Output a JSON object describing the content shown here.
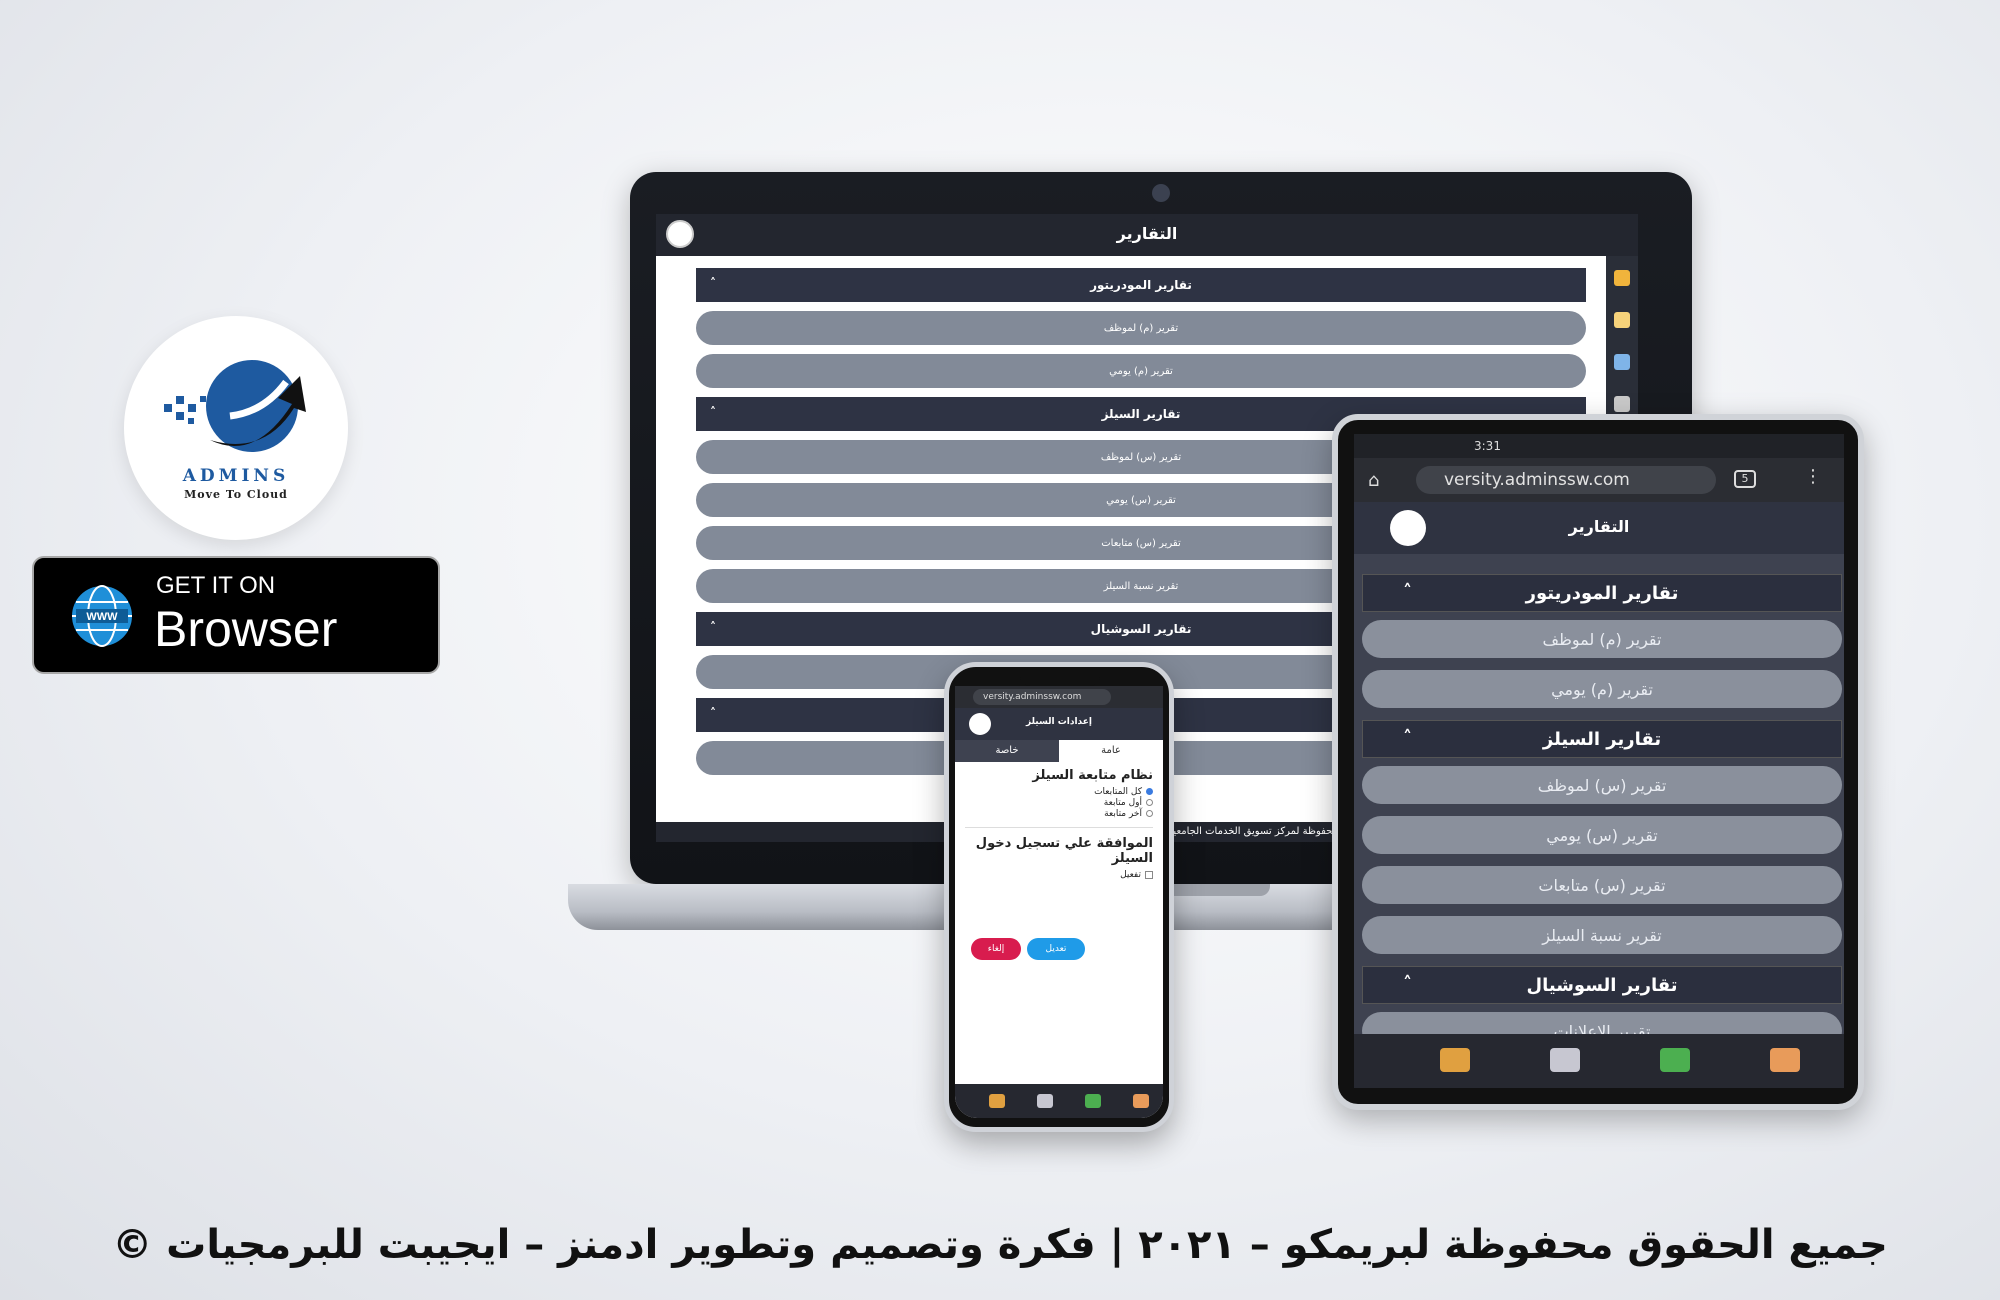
{
  "logo": {
    "word": "ADMINS",
    "tagline": "Move To Cloud"
  },
  "badge": {
    "small_text": "GET IT ON",
    "big_text": "Browser",
    "globe_text": "WWW"
  },
  "laptop": {
    "header_title": "التقارير",
    "sections": [
      {
        "title": "تقارير المودريتور",
        "items": [
          "تقرير (م) لموظف",
          "تقرير (م) يومي"
        ]
      },
      {
        "title": "تقارير السيلز",
        "items": [
          "تقرير (س) لموظف",
          "تقرير (س) يومي",
          "تقرير (س) متابعات",
          "تقرير نسبة السيلز"
        ]
      },
      {
        "title": "تقارير السوشيال",
        "items": [
          ""
        ]
      },
      {
        "title": "",
        "items": [
          ""
        ]
      }
    ],
    "footer_text": "© محفوظة لمركز تسويق الخدمات الجامعية | للبرمجيات"
  },
  "tablet": {
    "time": "3:31",
    "url": "versity.adminssw.com",
    "tab_count": "5",
    "header_title": "التقارير",
    "sections": [
      {
        "title": "تقارير المودريتور",
        "items": [
          "تقرير (م) لموظف",
          "تقرير (م) يومي"
        ]
      },
      {
        "title": "تقارير السيلز",
        "items": [
          "تقرير (س) لموظف",
          "تقرير (س) يومي",
          "تقرير (س) متابعات",
          "تقرير نسبة السيلز"
        ]
      },
      {
        "title": "تقارير السوشيال",
        "items": [
          "تقرير الاعلانات"
        ]
      }
    ]
  },
  "phone": {
    "url": "versity.adminssw.com",
    "header_title": "إعدادات السيلز",
    "tabs": {
      "general": "عامة",
      "private": "خاصة"
    },
    "follow_heading": "نظام متابعة السيلز",
    "options": [
      "كل المتابعات",
      "أول متابعة",
      "آخر متابعة"
    ],
    "login_heading": "الموافقة علي تسجيل دخول السيلز",
    "activate_label": "تفعيل",
    "edit_button": "تعديل",
    "cancel_button": "إلغاء"
  },
  "footer": {
    "copyright": "© جميع الحقوق محفوظة لبريمكو – ٢٠٢١ | فكرة وتصميم وتطوير ادمنز – ايجيبت للبرمجيات"
  },
  "colors": {
    "dark_header": "#23262f",
    "section_bg": "#2e3344",
    "item_bg": "#828a98",
    "edit_blue": "#1f9be8",
    "cancel_red": "#d81c4e",
    "brand_blue": "#1e5aa0"
  }
}
